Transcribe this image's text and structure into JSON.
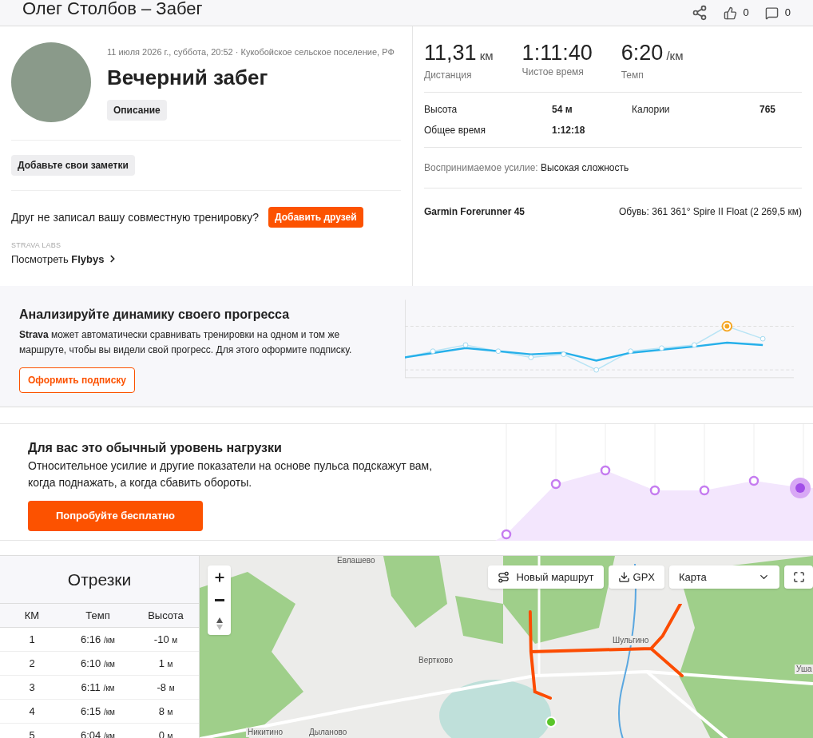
{
  "header": {
    "title": "Олег Столбов – Забег",
    "likes": "0",
    "comments": "0"
  },
  "activity": {
    "meta": "11 июля 2026 г., суббота, 20:52 · Кукобойское сельское поселение, РФ",
    "name": "Вечерний забег",
    "description_button": "Описание",
    "notes_button": "Добавьте свои заметки",
    "friends_prompt": "Друг не записал вашу совместную тренировку?",
    "friends_button": "Добавить друзей",
    "labs_label": "STRAVA LABS",
    "flybys_link": "Посмотреть **Flybys**"
  },
  "stats": {
    "primary": [
      {
        "value": "11,31",
        "unit": "км",
        "label": "Дистанция"
      },
      {
        "value": "1:11:40",
        "label": "Чистое время"
      },
      {
        "value": "6:20",
        "unit": "/км",
        "label": "Темп"
      }
    ],
    "secondary": [
      {
        "label": "Высота",
        "value": "54 м"
      },
      {
        "label": "Калории",
        "value": "765"
      },
      {
        "label": "Общее время",
        "value": "1:12:18"
      }
    ],
    "effort_label": "Воспринимаемое усилие:",
    "effort_value": "Высокая сложность",
    "device": "Garmin Forerunner 45",
    "shoes_label": "Обувь:",
    "shoes_value": "361 361° Spire II Float (2 269,5 км)"
  },
  "progress_promo": {
    "title": "Анализируйте динамику своего прогресса",
    "text": "**Strava** может автоматически сравнивать тренировки на одном и том же маршруте, чтобы вы видели свой прогресс. Для этого оформите подписку.",
    "button": "Оформить подписку"
  },
  "load_promo": {
    "title": "Для вас это обычный уровень нагрузки",
    "text": "Относительное усилие и другие показатели на основе пульса подскажут вам, когда поднажать, а когда сбавить обороты.",
    "button": "Попробуйте бесплатно"
  },
  "splits": {
    "title": "Отрезки",
    "columns": [
      "КМ",
      "Темп",
      "Высота"
    ],
    "rows": [
      {
        "km": "1",
        "pace": "6:16",
        "pace_unit": "/км",
        "elev": "-10",
        "elev_unit": "м"
      },
      {
        "km": "2",
        "pace": "6:10",
        "pace_unit": "/км",
        "elev": "1",
        "elev_unit": "м"
      },
      {
        "km": "3",
        "pace": "6:11",
        "pace_unit": "/км",
        "elev": "-8",
        "elev_unit": "м"
      },
      {
        "km": "4",
        "pace": "6:15",
        "pace_unit": "/км",
        "elev": "8",
        "elev_unit": "м"
      },
      {
        "km": "5",
        "pace": "6:04",
        "pace_unit": "/км",
        "elev": "0",
        "elev_unit": "м"
      }
    ]
  },
  "map": {
    "new_route_button": "Новый маршрут",
    "gpx_button": "GPX",
    "map_type": "Карта",
    "places": [
      {
        "name": "Евлашево"
      },
      {
        "name": "Вертково"
      },
      {
        "name": "Шульгино"
      },
      {
        "name": "Уша"
      },
      {
        "name": "Никитино"
      },
      {
        "name": "Дыланово"
      }
    ]
  }
}
